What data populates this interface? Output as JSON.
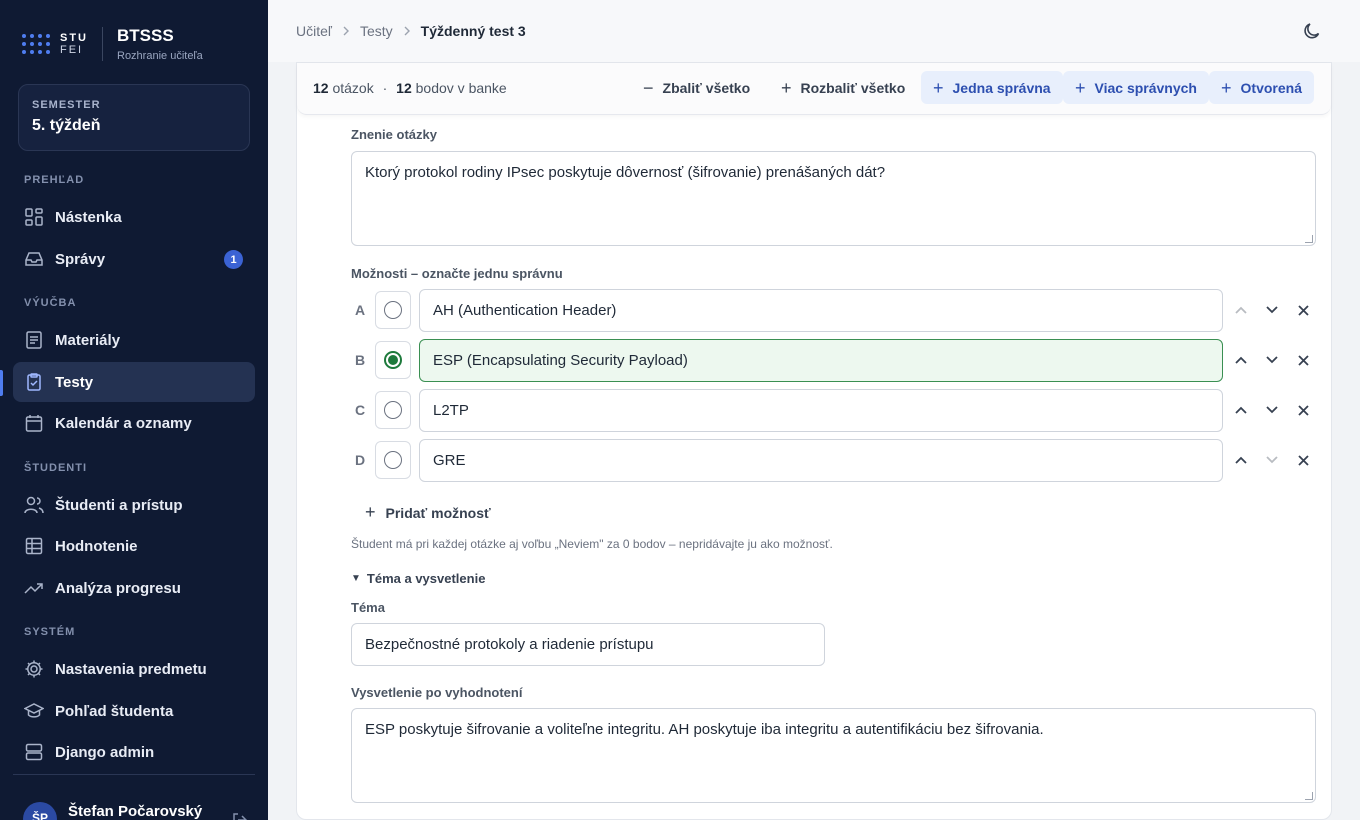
{
  "brand": {
    "logo_top": "STU",
    "logo_bottom": "FEI",
    "app_title": "BTSSS",
    "app_subtitle": "Rozhranie učiteľa"
  },
  "semester": {
    "label": "SEMESTER",
    "value": "5. týždeň"
  },
  "nav": {
    "section_overview": "PREHĽAD",
    "dashboard": "Nástenka",
    "messages": "Správy",
    "messages_badge": "1",
    "section_teaching": "VÝUČBA",
    "materials": "Materiály",
    "tests": "Testy",
    "calendar": "Kalendár a oznamy",
    "section_students": "ŠTUDENTI",
    "students_access": "Študenti a prístup",
    "grading": "Hodnotenie",
    "progress": "Analýza progresu",
    "section_system": "SYSTÉM",
    "settings": "Nastavenia predmetu",
    "student_view": "Pohľad študenta",
    "django_admin": "Django admin"
  },
  "user": {
    "initials": "ŠP",
    "name": "Štefan Počarovský"
  },
  "breadcrumb": {
    "item1": "Učiteľ",
    "item2": "Testy",
    "current": "Týždenný test 3"
  },
  "toolbar": {
    "questions_count": "12",
    "questions_label": "otázok",
    "dot": "·",
    "points_count": "12",
    "points_label": "bodov v banke",
    "collapse_all": "Zbaliť všetko",
    "expand_all": "Rozbaliť všetko",
    "add_single": "Jedna správna",
    "add_multi": "Viac správnych",
    "add_open": "Otvorená"
  },
  "question": {
    "text_label": "Znenie otázky",
    "text_value": "Ktorý protokol rodiny IPsec poskytuje dôvernosť (šifrovanie) prenášaných dát?",
    "options_label": "Možnosti – označte jednu správnu",
    "options": [
      {
        "letter": "A",
        "text": "AH (Authentication Header)",
        "correct": false
      },
      {
        "letter": "B",
        "text": "ESP (Encapsulating Security Payload)",
        "correct": true
      },
      {
        "letter": "C",
        "text": "L2TP",
        "correct": false
      },
      {
        "letter": "D",
        "text": "GRE",
        "correct": false
      }
    ],
    "add_option": "Pridať možnosť",
    "hint": "Študent má pri každej otázke aj voľbu „Neviem\" za 0 bodov – nepridávajte ju ako možnosť.",
    "topic_section": "Téma a vysvetlenie",
    "topic_label": "Téma",
    "topic_value": "Bezpečnostné protokoly a riadenie prístupu",
    "explanation_label": "Vysvetlenie po vyhodnotení",
    "explanation_value": "ESP poskytuje šifrovanie a voliteľne integritu. AH poskytuje iba integritu a autentifikáciu bez šifrovania."
  },
  "colors": {
    "sidebar_bg": "#0f1a33",
    "accent": "#4f7df0",
    "correct_green": "#1e7a3c",
    "primary_btn_bg": "#e8effc"
  }
}
